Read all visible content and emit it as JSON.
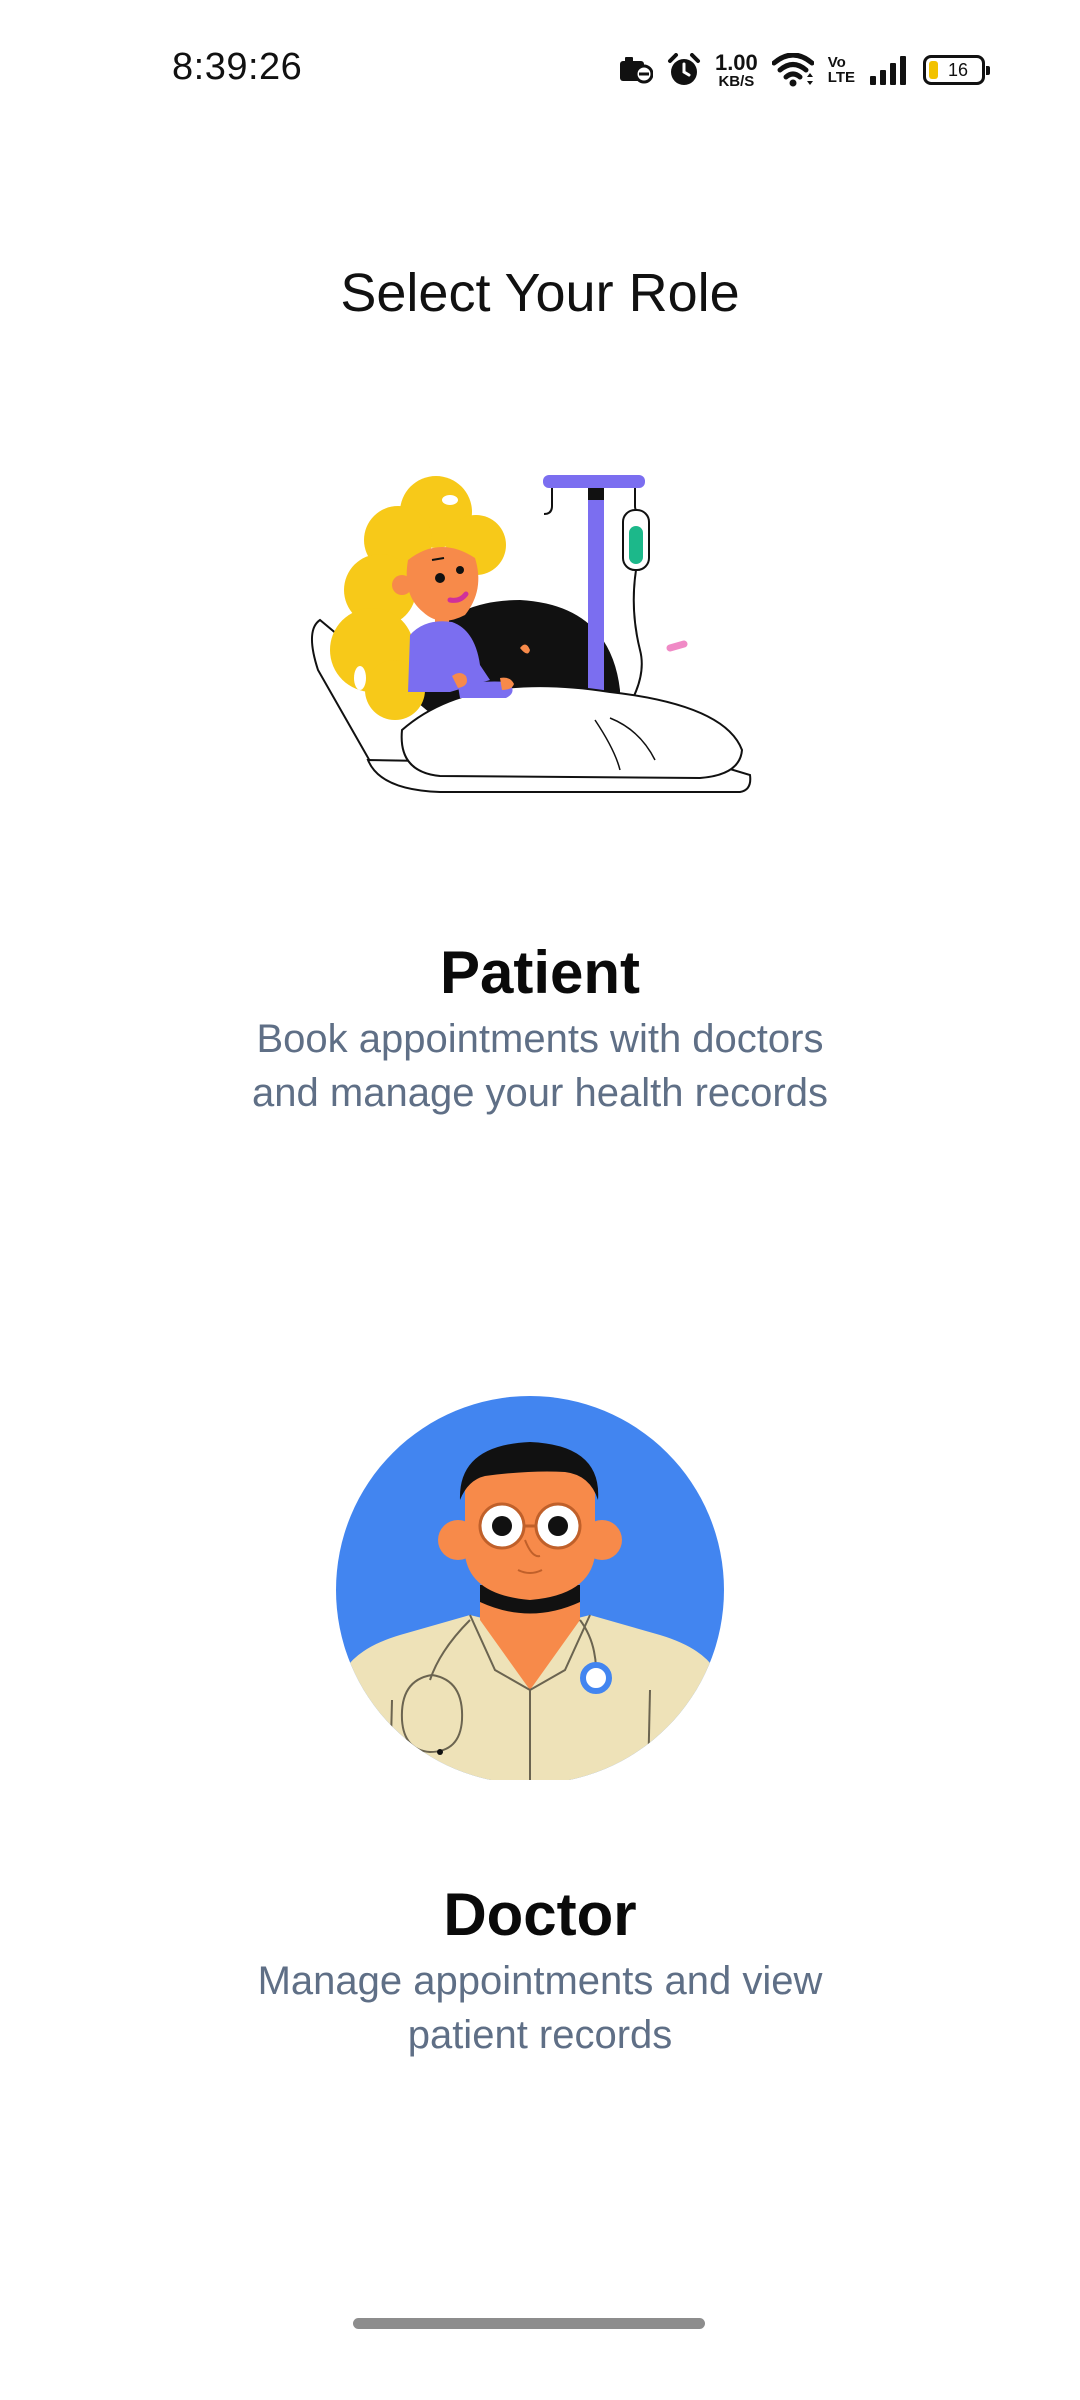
{
  "status_bar": {
    "time": "8:39:26",
    "net_speed_value": "1.00",
    "net_speed_unit": "KB/S",
    "volte_top": "Vo",
    "volte_bottom": "LTE",
    "battery_level": "16"
  },
  "page": {
    "title": "Select Your Role"
  },
  "roles": [
    {
      "title": "Patient",
      "description_line1": "Book appointments with doctors",
      "description_line2": "and manage your health records",
      "illustration": "patient-in-bed-illustration"
    },
    {
      "title": "Doctor",
      "description_line1": "Manage appointments and view",
      "description_line2": "patient records",
      "illustration": "doctor-avatar-illustration"
    }
  ],
  "colors": {
    "description_text": "#5f6f86",
    "doctor_circle": "#4285f0",
    "iv_stand": "#7b6ef0",
    "hair": "#f7c919",
    "skin": "#f78a4a",
    "coat": "#eee2b8"
  }
}
